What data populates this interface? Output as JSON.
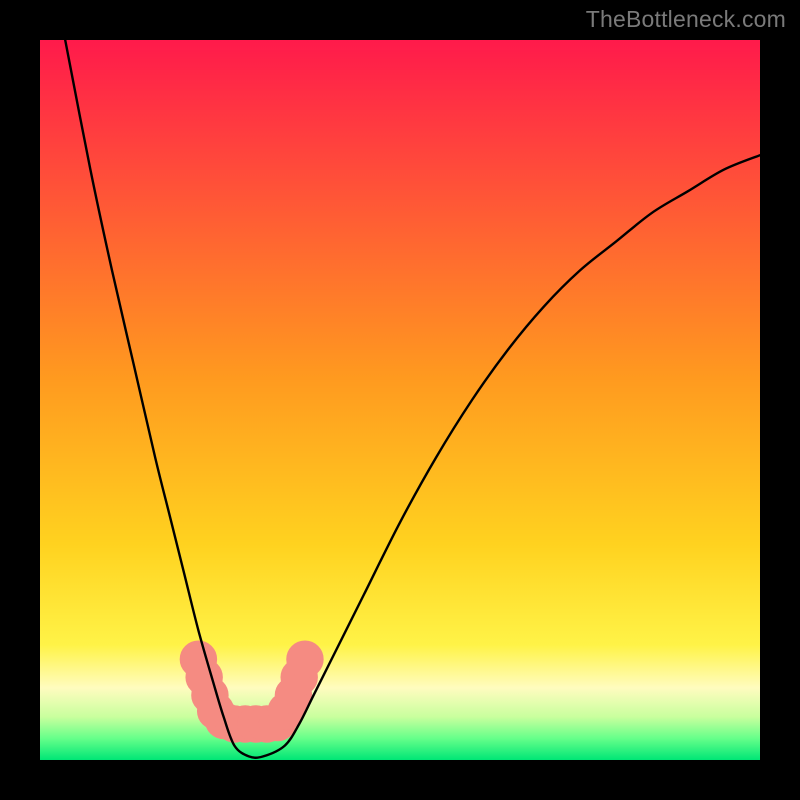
{
  "watermark": {
    "text": "TheBottleneck.com"
  },
  "chart_data": {
    "type": "line",
    "title": "",
    "xlabel": "",
    "ylabel": "",
    "xlim": [
      0,
      100
    ],
    "ylim": [
      0,
      100
    ],
    "grid": false,
    "legend": false,
    "background_gradient": {
      "stops": [
        {
          "offset": 0.0,
          "color": "#ff1a4b"
        },
        {
          "offset": 0.47,
          "color": "#ff9a1f"
        },
        {
          "offset": 0.7,
          "color": "#ffd21f"
        },
        {
          "offset": 0.84,
          "color": "#fff347"
        },
        {
          "offset": 0.9,
          "color": "#fffcbf"
        },
        {
          "offset": 0.94,
          "color": "#c9ff9e"
        },
        {
          "offset": 0.97,
          "color": "#66ff8a"
        },
        {
          "offset": 1.0,
          "color": "#00e676"
        }
      ]
    },
    "series": [
      {
        "name": "bottleneck-curve",
        "stroke": "#000000",
        "stroke_width": 2.4,
        "x": [
          3.5,
          7,
          10,
          13,
          16,
          18,
          20,
          22,
          24,
          25.5,
          27,
          29,
          31,
          34,
          36,
          38,
          41,
          45,
          50,
          55,
          60,
          65,
          70,
          75,
          80,
          85,
          90,
          95,
          100
        ],
        "values": [
          100,
          82,
          68,
          55,
          42,
          34,
          26,
          18,
          11,
          6,
          2,
          0.5,
          0.5,
          2,
          5,
          9,
          15,
          23,
          33,
          42,
          50,
          57,
          63,
          68,
          72,
          76,
          79,
          82,
          84
        ]
      }
    ],
    "annotations": {
      "coral_blobs": {
        "color": "#f58b82",
        "points": [
          {
            "x": 22.0,
            "y": 14.0,
            "r": 2.6
          },
          {
            "x": 22.8,
            "y": 11.5,
            "r": 2.6
          },
          {
            "x": 23.6,
            "y": 9.0,
            "r": 2.6
          },
          {
            "x": 24.4,
            "y": 6.8,
            "r": 2.6
          },
          {
            "x": 25.5,
            "y": 5.5,
            "r": 2.6
          },
          {
            "x": 27.0,
            "y": 5.0,
            "r": 2.6
          },
          {
            "x": 28.5,
            "y": 5.0,
            "r": 2.6
          },
          {
            "x": 30.0,
            "y": 5.0,
            "r": 2.6
          },
          {
            "x": 31.5,
            "y": 5.0,
            "r": 2.6
          },
          {
            "x": 33.0,
            "y": 5.2,
            "r": 2.6
          },
          {
            "x": 34.2,
            "y": 6.8,
            "r": 2.6
          },
          {
            "x": 35.2,
            "y": 9.0,
            "r": 2.6
          },
          {
            "x": 36.0,
            "y": 11.5,
            "r": 2.6
          },
          {
            "x": 36.8,
            "y": 14.0,
            "r": 2.6
          }
        ]
      }
    }
  }
}
